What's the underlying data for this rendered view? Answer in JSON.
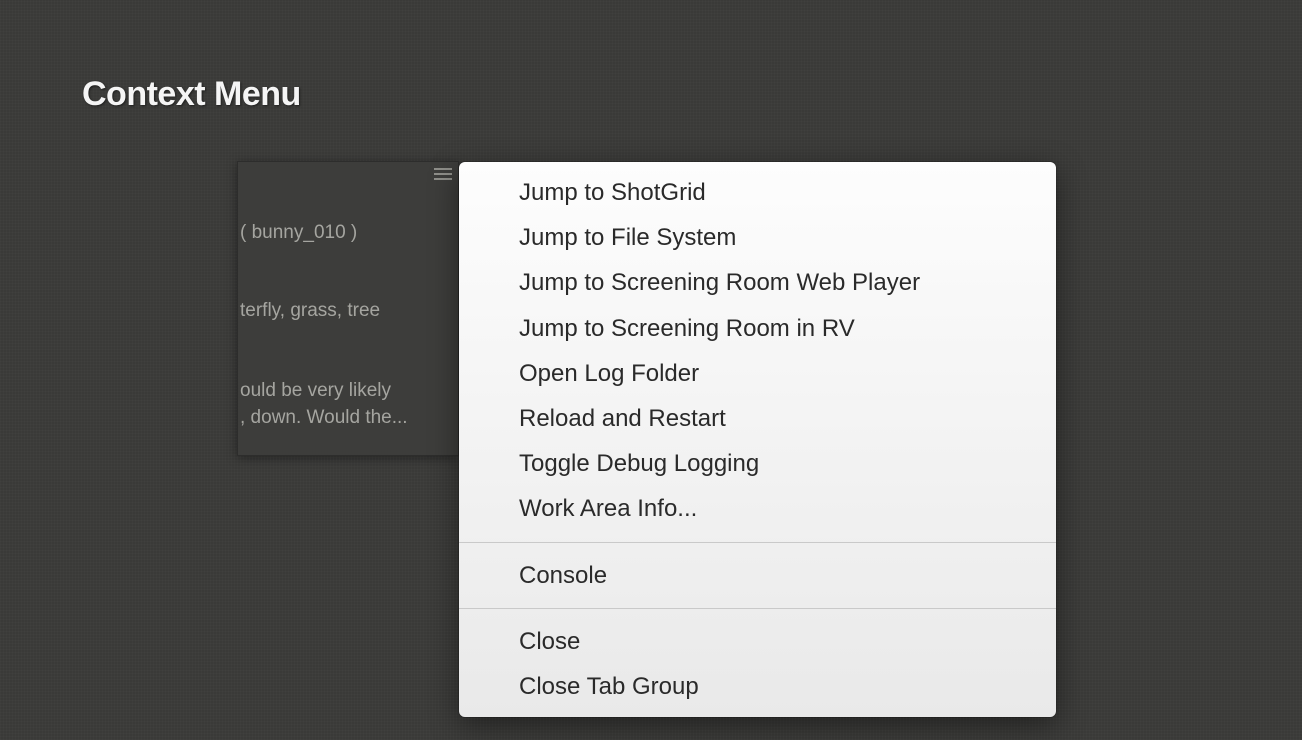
{
  "page": {
    "title": "Context Menu"
  },
  "panel": {
    "line1": "( bunny_010 )",
    "line2": "terfly, grass, tree",
    "line3": "ould be very likely",
    "line4": ", down. Would the..."
  },
  "menu": {
    "groups": [
      [
        "Jump to ShotGrid",
        "Jump to File System",
        "Jump to Screening Room Web Player",
        "Jump to Screening Room in RV",
        "Open Log Folder",
        "Reload and Restart",
        "Toggle Debug Logging",
        "Work Area Info..."
      ],
      [
        "Console"
      ],
      [
        "Close",
        "Close Tab Group"
      ]
    ]
  }
}
